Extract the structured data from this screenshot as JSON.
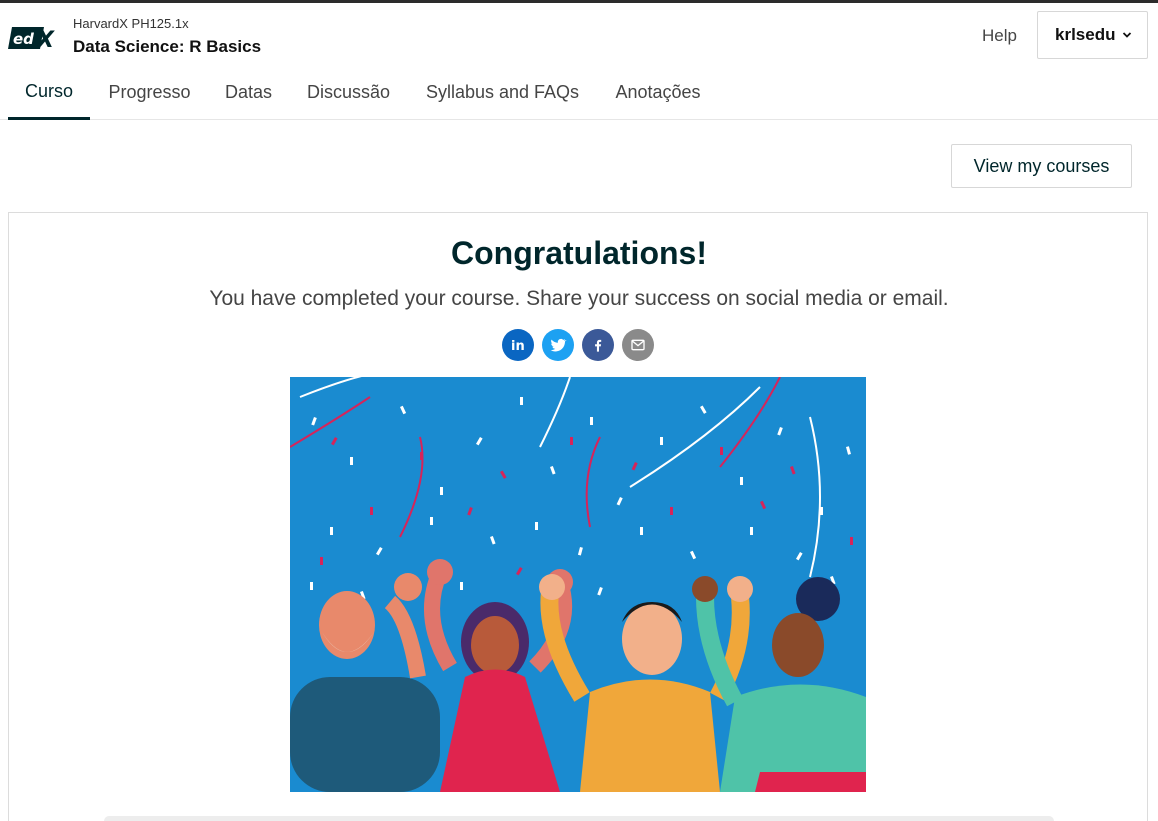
{
  "header": {
    "logo_text": "edX",
    "course_org": "HarvardX PH125.1x",
    "course_title": "Data Science: R Basics",
    "help_label": "Help",
    "username": "krlsedu"
  },
  "tabs": [
    {
      "label": "Curso",
      "active": true
    },
    {
      "label": "Progresso",
      "active": false
    },
    {
      "label": "Datas",
      "active": false
    },
    {
      "label": "Discussão",
      "active": false
    },
    {
      "label": "Syllabus and FAQs",
      "active": false
    },
    {
      "label": "Anotações",
      "active": false
    }
  ],
  "view_courses_label": "View my courses",
  "celebration": {
    "title": "Congratulations!",
    "message": "You have completed your course. Share your success on social media or email.",
    "share_buttons": [
      {
        "name": "linkedin-icon",
        "color": "#0a66c2"
      },
      {
        "name": "twitter-icon",
        "color": "#1da1f2"
      },
      {
        "name": "facebook-icon",
        "color": "#3b5998"
      },
      {
        "name": "email-icon",
        "color": "#8a8a8a"
      }
    ]
  },
  "colors": {
    "primary": "#00262b",
    "illustration_bg": "#1a8bd0"
  }
}
